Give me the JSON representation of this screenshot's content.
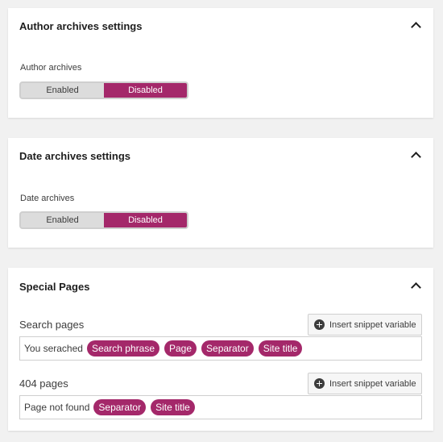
{
  "author_panel": {
    "title": "Author archives settings",
    "field_label": "Author archives",
    "toggle": {
      "enabled": "Enabled",
      "disabled": "Disabled",
      "selected": "Disabled"
    }
  },
  "date_panel": {
    "title": "Date archives settings",
    "field_label": "Date archives",
    "toggle": {
      "enabled": "Enabled",
      "disabled": "Disabled",
      "selected": "Disabled"
    }
  },
  "special_panel": {
    "title": "Special Pages",
    "search": {
      "label": "Search pages",
      "insert_button": "Insert snippet variable",
      "text": "You serached",
      "variables": [
        "Search phrase",
        "Page",
        "Separator",
        "Site title"
      ]
    },
    "not_found": {
      "label": "404 pages",
      "insert_button": "Insert snippet variable",
      "text": "Page not found",
      "variables": [
        "Separator",
        "Site title"
      ]
    }
  },
  "colors": {
    "accent": "#a4286a",
    "background": "#f1f1f1",
    "panel": "#ffffff",
    "toggle_off": "#dcdcdc"
  },
  "icons": [
    "chevron-up-icon",
    "plus-circle-icon"
  ]
}
